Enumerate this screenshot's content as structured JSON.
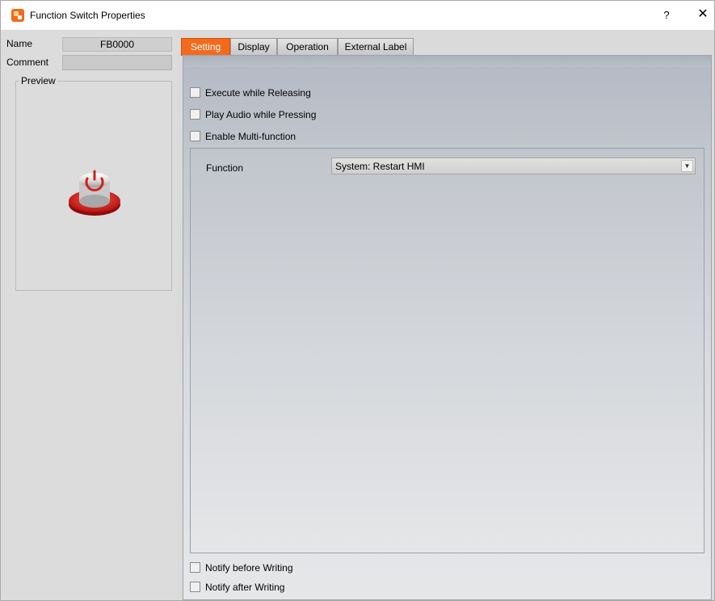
{
  "window": {
    "title": "Function Switch Properties",
    "help_label": "?",
    "close_label": "✕"
  },
  "left": {
    "name_label": "Name",
    "name_value": "FB0000",
    "comment_label": "Comment",
    "comment_value": "",
    "preview_label": "Preview"
  },
  "tabs": [
    {
      "label": "Setting",
      "active": true
    },
    {
      "label": "Display",
      "active": false
    },
    {
      "label": "Operation",
      "active": false
    },
    {
      "label": "External Label",
      "active": false
    }
  ],
  "setting": {
    "execute_releasing": {
      "label": "Execute while Releasing",
      "checked": false
    },
    "play_audio": {
      "label": "Play Audio while Pressing",
      "checked": false
    },
    "multi_function": {
      "label": "Enable Multi-function",
      "checked": false
    },
    "function_label": "Function",
    "function_value": "System: Restart HMI",
    "notify_before": {
      "label": "Notify before Writing",
      "checked": false
    },
    "notify_after": {
      "label": "Notify after Writing",
      "checked": false
    }
  },
  "colors": {
    "accent": "#f26a1b",
    "button_red": "#d0221e"
  },
  "icons": {
    "app": "app-logo-icon",
    "dropdown": "chevron-down-icon",
    "preview": "power-button-icon"
  }
}
